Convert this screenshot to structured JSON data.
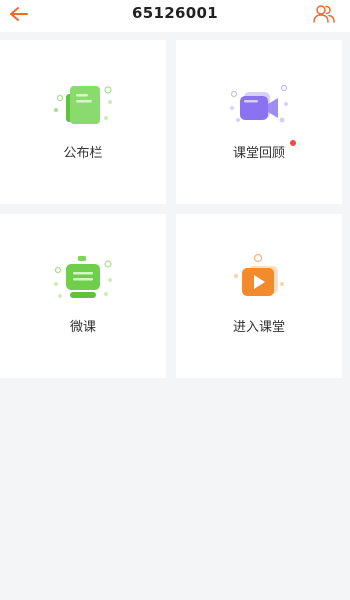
{
  "header": {
    "title": "65126001",
    "back_icon": "arrow-left-icon",
    "members_icon": "users-icon",
    "accent_color": "#f06a2c"
  },
  "cards": [
    {
      "label": "公布栏",
      "icon": "bulletin-board-icon",
      "color": "#6fcf4a",
      "badge": false
    },
    {
      "label": "课堂回顾",
      "icon": "video-camera-icon",
      "color": "#8b72f0",
      "badge": true
    },
    {
      "label": "微课",
      "icon": "chat-message-icon",
      "color": "#6fcf4a",
      "badge": false
    },
    {
      "label": "进入课堂",
      "icon": "play-button-icon",
      "color": "#f38a2c",
      "badge": false
    }
  ]
}
